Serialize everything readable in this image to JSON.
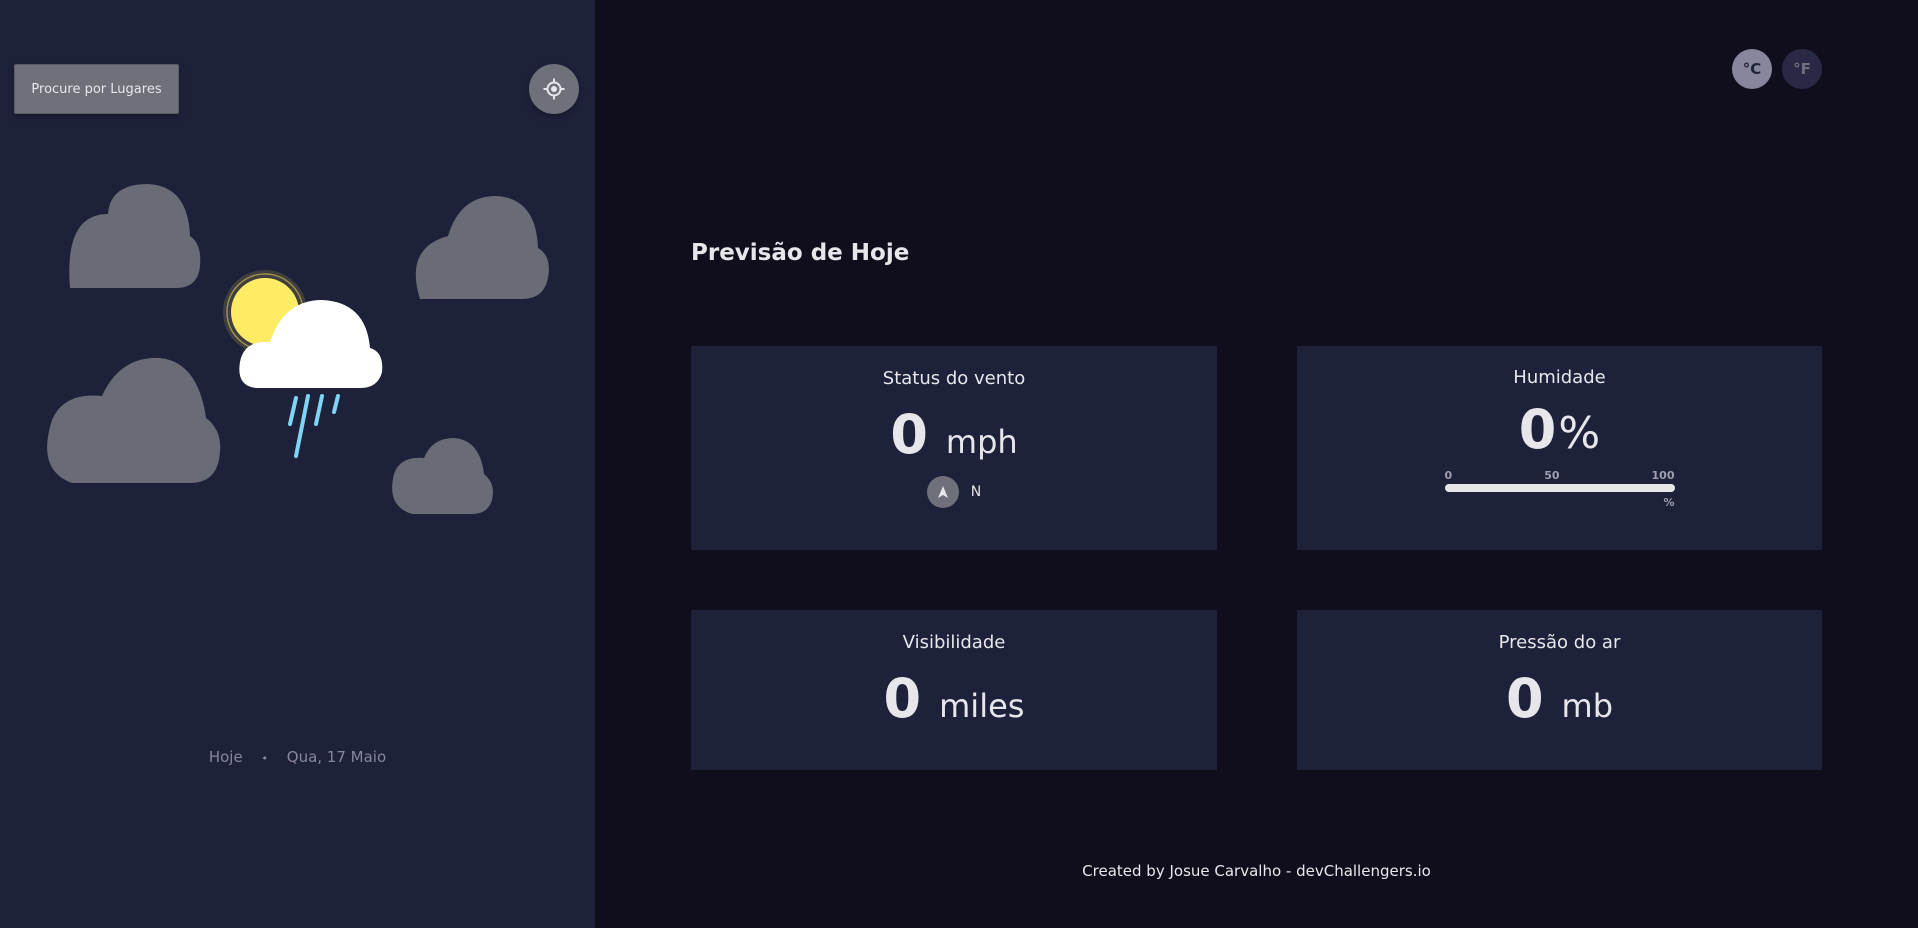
{
  "sidebar": {
    "search_label": "Procure por Lugares",
    "locate_icon": "crosshair-icon",
    "weather_icon": "light-rain-icon",
    "date": {
      "today": "Hoje",
      "separator": "•",
      "date": "Qua, 17 Maio"
    }
  },
  "units": {
    "celsius": "°C",
    "fahrenheit": "°F"
  },
  "highlights": {
    "title": "Previsão de Hoje",
    "wind": {
      "title": "Status do vento",
      "value": "0",
      "unit": "mph",
      "direction": "N",
      "direction_icon": "navigation-arrow-icon"
    },
    "humidity": {
      "title": "Humidade",
      "value": "0",
      "unit": "%",
      "scale": {
        "min": "0",
        "mid": "50",
        "max": "100",
        "pct": "%"
      },
      "level_percent": 0
    },
    "visibility": {
      "title": "Visibilidade",
      "value": "0",
      "unit": "miles"
    },
    "pressure": {
      "title": "Pressão do ar",
      "value": "0",
      "unit": "mb"
    }
  },
  "footer": "Created by Josue Carvalho - devChallengers.io",
  "colors": {
    "sidebar_bg": "#1e213a",
    "main_bg": "#100e1d",
    "card_bg": "#1e213a",
    "button_gray": "#6e707a",
    "text": "#e7e7eb",
    "muted": "#88869d",
    "accent_yellow": "#ffec65"
  }
}
